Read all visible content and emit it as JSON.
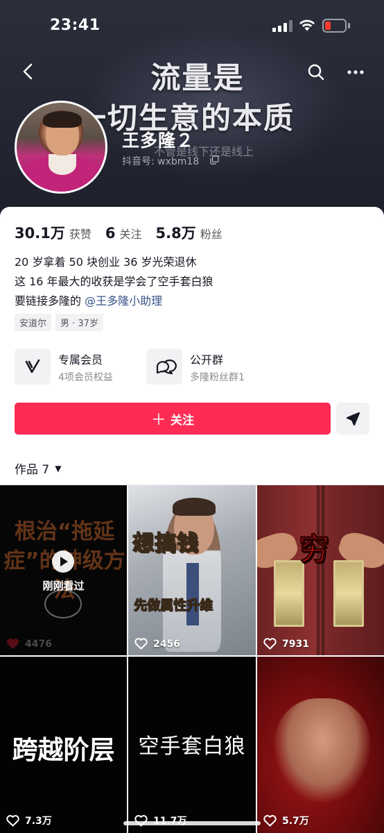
{
  "status_bar": {
    "time": "23:41",
    "battery_color": "#ff3b30"
  },
  "cover": {
    "line1": "流量是",
    "line2": "一切生意的本质",
    "line3": "不管是线下还是线上"
  },
  "profile": {
    "name": "王多隆２",
    "douyin_id": "抖音号: wxbm18",
    "icons": [
      "back-icon",
      "search-icon",
      "more-icon",
      "copy-icon"
    ]
  },
  "stats": [
    {
      "num": "30.1万",
      "label": "获赞"
    },
    {
      "num": "6",
      "label": "关注"
    },
    {
      "num": "5.8万",
      "label": "粉丝"
    }
  ],
  "bio": {
    "line1": "20 岁拿着 50 块创业 36 岁光荣退休",
    "line2": "这 16 年最大的收获是学会了空手套白狼",
    "line3_prefix": "要链接多隆的 ",
    "line3_mention": "@王多隆小助理",
    "mention_color": "#385387"
  },
  "tags": [
    "安道尔",
    "男 · 37岁"
  ],
  "features": [
    {
      "title": "专属会员",
      "subtitle": "4项会员权益",
      "icon": "vip-v-icon"
    },
    {
      "title": "公开群",
      "subtitle": "多隆粉丝群1",
      "icon": "chat-bubbles-icon"
    }
  ],
  "actions": {
    "follow_label": "关注",
    "follow_plus": "＋",
    "follow_color": "#fe2c55",
    "share_icon": "send-icon"
  },
  "works_tab": {
    "label": "作品 7",
    "caret": "▼"
  },
  "videos": [
    {
      "title": "根治“拖延症”的神级方法",
      "overlay": "刚刚看过",
      "likes": "4476",
      "watched": true
    },
    {
      "title": "想搞钱",
      "subtitle": "先做属性升维",
      "likes": "2456"
    },
    {
      "title": "穷",
      "likes": "7931"
    },
    {
      "title": "跨越阶层",
      "likes": "7.3万"
    },
    {
      "title": "空手套白狼",
      "likes": "11.7万"
    },
    {
      "title": "",
      "likes": "5.7万"
    }
  ]
}
